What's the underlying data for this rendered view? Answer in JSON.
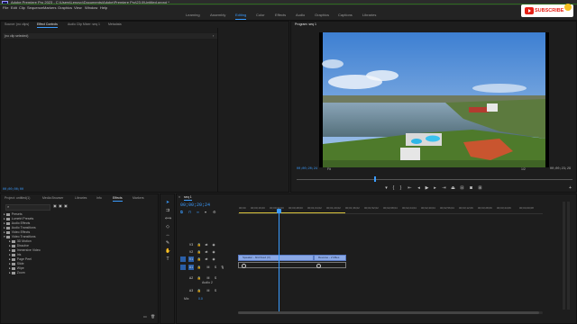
{
  "window": {
    "title": "Adobe Premiere Pro 2023 - C:\\Users\\Lenovo\\Documents\\Adobe\\Premiere Pro\\23.0\\Untitled.prproj *"
  },
  "menu": [
    "File",
    "Edit",
    "Clip",
    "Sequence",
    "Markers",
    "Graphics",
    "View",
    "Window",
    "Help"
  ],
  "workspaces": {
    "items": [
      "Learning",
      "Assembly",
      "Editing",
      "Color",
      "Effects",
      "Audio",
      "Graphics",
      "Captions",
      "Libraries"
    ],
    "active": "Editing"
  },
  "subscribe": {
    "label": "SUBSCRIBE"
  },
  "source_panel": {
    "tabs": [
      "Source: (no clips)",
      "Effect Controls",
      "Audio Clip Mixer: seq 1",
      "Metadata"
    ],
    "active_tab": "Effect Controls",
    "no_clip_text": "(no clip selected)",
    "timecode": "00;00;00;00"
  },
  "program_monitor": {
    "title": "Program: seq 1",
    "timecode": "00;00;20;24",
    "fit": "Fit",
    "scale": "1/2",
    "duration": "00;00;23;29"
  },
  "project_panel": {
    "tabs": [
      "Project: untitled(1)",
      "Media Browser",
      "Libraries",
      "Info",
      "Effects",
      "Markers"
    ],
    "active_tab": "Effects",
    "tree": [
      "Presets",
      "Lumetri Presets",
      "Audio Effects",
      "Audio Transitions",
      "Video Effects",
      "Video Transitions",
      "3D Motion",
      "Dissolve",
      "Immersive Video",
      "Iris",
      "Page Peel",
      "Slide",
      "Wipe",
      "Zoom"
    ]
  },
  "timeline": {
    "sequence": "seq 1",
    "timecode": "00;00;20;24",
    "ruler": [
      "00;00",
      "00;00;16;00",
      "00;00;32;00",
      "00;00;48;00",
      "00;01;04;02",
      "00;01;20;02",
      "00;01;36;02",
      "00;01;52;02",
      "00;02;08;04",
      "00;02;24;04",
      "00;02;40;04",
      "00;02;56;04",
      "00;03;12;06",
      "00;03;28;06",
      "00;03;44;06",
      "00;04;00;08"
    ],
    "video_tracks": [
      "V3",
      "V2",
      "V1"
    ],
    "audio_tracks": [
      "A1",
      "A2",
      "A3"
    ],
    "audio2_label": "Audio 2",
    "mix": "Mix",
    "mix_value": "0.0",
    "clips": [
      {
        "name": "Speaker - bird fixed (V)"
      },
      {
        "name": "Reverse - 2 Miles"
      }
    ]
  },
  "colors": {
    "accent": "#3b9cff",
    "clip": "#8aa8e6",
    "playhead": "#3b9cff",
    "subscribe": "#e62117"
  }
}
